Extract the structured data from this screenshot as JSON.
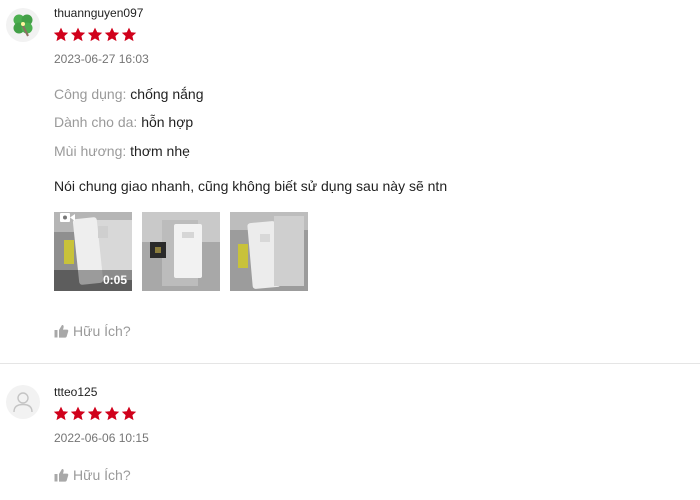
{
  "colors": {
    "star": "#d0011b",
    "muted": "#9a9a9a",
    "divider": "#e5e5e5"
  },
  "reviews": [
    {
      "username": "thuannguyen097",
      "avatar_icon": "clover-icon",
      "rating": 5,
      "date": "2023-06-27 16:03",
      "attributes": [
        {
          "label": "Công dụng:",
          "value": "chống nắng"
        },
        {
          "label": "Dành cho da:",
          "value": "hỗn hợp"
        },
        {
          "label": "Mùi hương:",
          "value": "thơm nhẹ"
        }
      ],
      "comment": "Nói chung giao nhanh, cũng không biết sử dụng sau này sẽ ntn",
      "media": [
        {
          "type": "video",
          "duration": "0:05",
          "icon": "video-camera-icon"
        },
        {
          "type": "image"
        },
        {
          "type": "image"
        }
      ],
      "helpful_label": "Hữu Ích?"
    },
    {
      "username": "ttteo125",
      "avatar_icon": "user-icon",
      "rating": 5,
      "date": "2022-06-06 10:15",
      "helpful_label": "Hữu Ích?"
    }
  ]
}
